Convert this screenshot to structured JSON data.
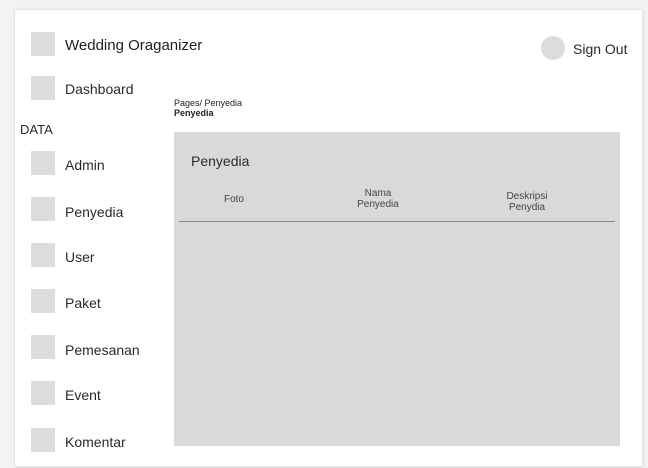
{
  "header": {
    "app_title": "Wedding Oraganizer",
    "sign_out_label": "Sign Out"
  },
  "sidebar": {
    "dashboard_label": "Dashboard",
    "section_label": "DATA",
    "items": [
      {
        "label": "Admin"
      },
      {
        "label": "Penyedia"
      },
      {
        "label": "User"
      },
      {
        "label": "Paket"
      },
      {
        "label": "Pemesanan"
      },
      {
        "label": "Event"
      },
      {
        "label": "Komentar"
      }
    ]
  },
  "breadcrumb": {
    "path": "Pages/ Penyedia",
    "current": "Penyedia"
  },
  "panel": {
    "title": "Penyedia",
    "columns": [
      {
        "line1": "Foto",
        "line2": ""
      },
      {
        "line1": "Nama",
        "line2": "Penyedia"
      },
      {
        "line1": "Deskripsi",
        "line2": "Penydia"
      }
    ],
    "rows": []
  },
  "colors": {
    "placeholder": "#dcdcdc",
    "panel_background": "#d9d9d9",
    "divider": "#8a8a8a"
  },
  "icons": {
    "logo": "logo-placeholder-icon",
    "avatar": "user-avatar-icon",
    "nav": "nav-placeholder-icon"
  }
}
